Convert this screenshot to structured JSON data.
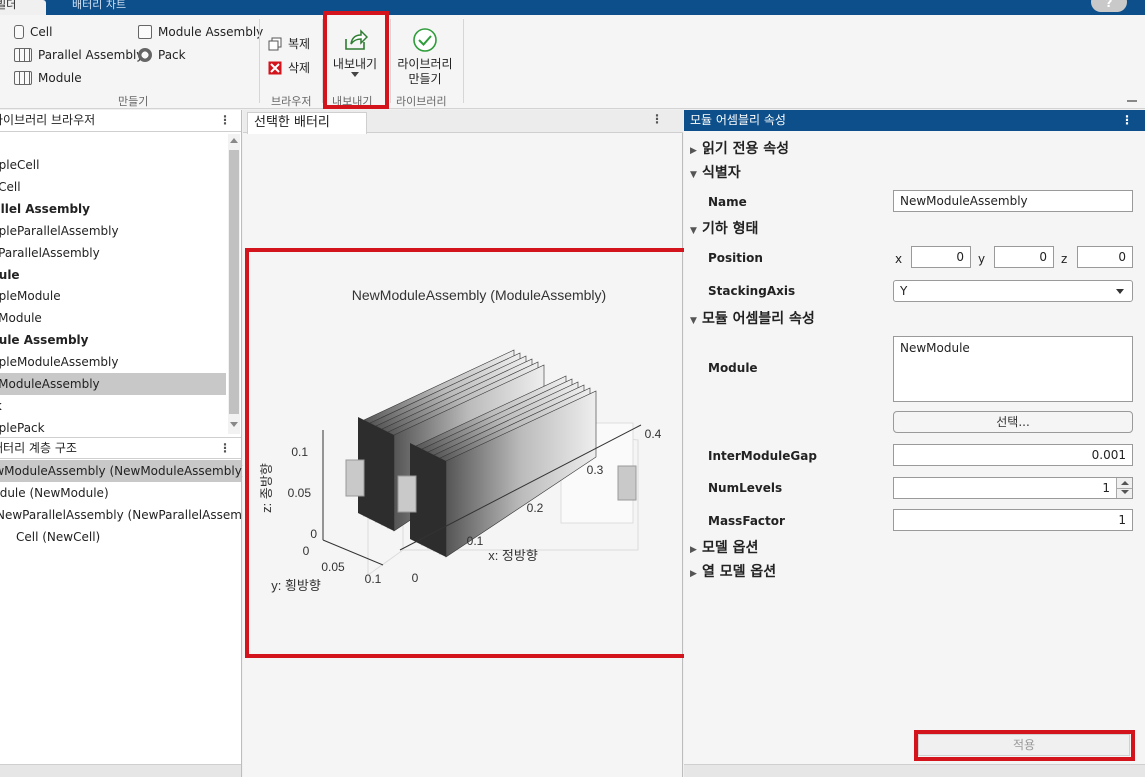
{
  "tabs": {
    "active": "빌더",
    "other": "배터리 차트",
    "help": "?"
  },
  "ribbon": {
    "create": {
      "cell": "Cell",
      "parallel_assembly": "Parallel Assembly",
      "module": "Module",
      "module_assembly": "Module Assembly",
      "pack": "Pack",
      "group_label": "만들기"
    },
    "browser": {
      "duplicate": "복제",
      "delete": "삭제",
      "group_label": "브라우저"
    },
    "export": {
      "label": "내보내기",
      "group_label": "내보내기"
    },
    "library": {
      "label_line1": "라이브러리",
      "label_line2": "만들기",
      "group_label": "라이브러리"
    }
  },
  "left": {
    "browser_title": "라이브러리 브라우저",
    "browser_items": [
      {
        "text": "SampleCell",
        "bold": false,
        "selected": false
      },
      {
        "text": "NewCell",
        "bold": false,
        "selected": false
      },
      {
        "text": "Parallel Assembly",
        "bold": true,
        "selected": false
      },
      {
        "text": "SampleParallelAssembly",
        "bold": false,
        "selected": false
      },
      {
        "text": "NewParallelAssembly",
        "bold": false,
        "selected": false
      },
      {
        "text": "Module",
        "bold": true,
        "selected": false
      },
      {
        "text": "SampleModule",
        "bold": false,
        "selected": false
      },
      {
        "text": "NewModule",
        "bold": false,
        "selected": false
      },
      {
        "text": "Module Assembly",
        "bold": true,
        "selected": false
      },
      {
        "text": "SampleModuleAssembly",
        "bold": false,
        "selected": false
      },
      {
        "text": "NewModuleAssembly",
        "bold": false,
        "selected": true
      },
      {
        "text": "Pack",
        "bold": true,
        "selected": false
      },
      {
        "text": "SamplePack",
        "bold": false,
        "selected": false
      }
    ],
    "hierarchy_title": "배터리 계층 구조",
    "hierarchy_items": [
      {
        "text": "NewModuleAssembly (NewModuleAssembly)",
        "selected": true
      },
      {
        "text": "Module (NewModule)",
        "selected": false
      },
      {
        "text": "NewParallelAssembly (NewParallelAssembly)",
        "selected": false
      },
      {
        "text": "Cell (NewCell)",
        "selected": false
      }
    ]
  },
  "center": {
    "tab_title": "선택한 배터리",
    "plot": {
      "title": "NewModuleAssembly (ModuleAssembly)",
      "x_label": "x: 정방향",
      "y_label": "y: 횡방향",
      "z_label": "z: 종방향",
      "x_ticks": [
        "0",
        "0.1",
        "0.2",
        "0.3",
        "0.4"
      ],
      "y_ticks": [
        "0",
        "0.05",
        "0.1"
      ],
      "z_ticks": [
        "0",
        "0.05",
        "0.1"
      ]
    }
  },
  "right": {
    "header": "모듈 어셈블리 속성",
    "sections": {
      "readonly": "읽기 전용 속성",
      "identifier": "식별자",
      "geometry": "기하 형태",
      "module_assembly": "모듈 어셈블리 속성",
      "model_options": "모델 옵션",
      "thermal_options": "열 모델 옵션"
    },
    "name_label": "Name",
    "name_value": "NewModuleAssembly",
    "position_label": "Position",
    "pos_x_label": "x",
    "pos_x": "0",
    "pos_y_label": "y",
    "pos_y": "0",
    "pos_z_label": "z",
    "pos_z": "0",
    "stacking_label": "StackingAxis",
    "stacking_value": "Y",
    "module_label": "Module",
    "module_value": "NewModule",
    "select_button": "선택...",
    "gap_label": "InterModuleGap",
    "gap_value": "0.001",
    "levels_label": "NumLevels",
    "levels_value": "1",
    "mass_label": "MassFactor",
    "mass_value": "1",
    "apply_button": "적용"
  },
  "colors": {
    "accent": "#0d4f8b",
    "highlight": "#d4141c",
    "selection": "#c8c8c8"
  }
}
